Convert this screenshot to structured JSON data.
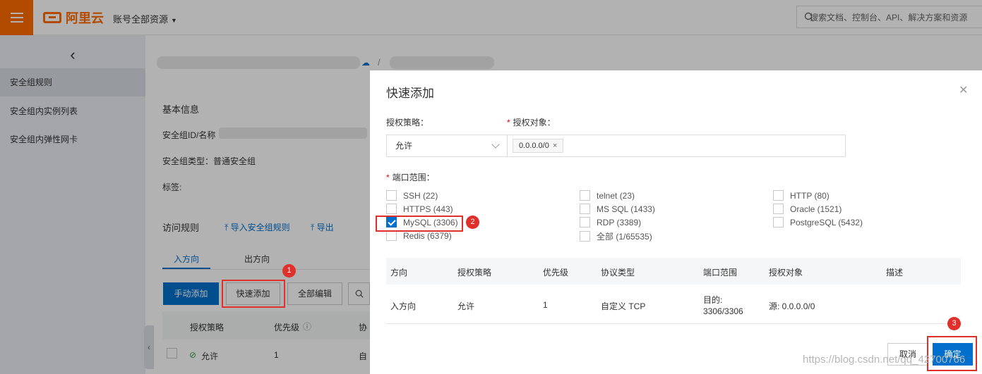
{
  "topbar": {
    "logo": "阿里云",
    "account": "账号全部资源",
    "search_placeholder": "搜索文档、控制台、API、解决方案和资源"
  },
  "sidebar": {
    "items": [
      {
        "label": "安全组规则",
        "active": true
      },
      {
        "label": "安全组内实例列表"
      },
      {
        "label": "安全组内弹性网卡"
      }
    ]
  },
  "main": {
    "breadcrumb_sep": "/",
    "basic_info": "基本信息",
    "sg_id_label": "安全组ID/名称",
    "sg_type": "安全组类型：普通安全组",
    "tags_label": "标签:",
    "rules_title": "访问规则",
    "import_label": "导入安全组规则",
    "export_label": "导出",
    "tabs": [
      {
        "label": "入方向",
        "active": true
      },
      {
        "label": "出方向"
      }
    ],
    "buttons": {
      "manual": "手动添加",
      "quick": "快速添加",
      "edit_all": "全部编辑"
    },
    "table_headers": [
      "授权策略",
      "优先级"
    ],
    "row": {
      "policy": "允许",
      "priority": "1",
      "proto": "自定"
    }
  },
  "modal": {
    "title": "快速添加",
    "policy_label": "授权策略：",
    "target_label": "授权对象：",
    "policy_value": "允许",
    "target_tag": "0.0.0.0/0",
    "port_label": "端口范围：",
    "ports": [
      {
        "label": "SSH (22)",
        "checked": false
      },
      {
        "label": "telnet (23)",
        "checked": false
      },
      {
        "label": "HTTP (80)",
        "checked": false
      },
      {
        "label": "HTTPS (443)",
        "checked": false
      },
      {
        "label": "MS SQL (1433)",
        "checked": false
      },
      {
        "label": "Oracle (1521)",
        "checked": false
      },
      {
        "label": "MySQL (3306)",
        "checked": true
      },
      {
        "label": "RDP (3389)",
        "checked": false
      },
      {
        "label": "PostgreSQL (5432)",
        "checked": false
      },
      {
        "label": "Redis (6379)",
        "checked": false
      },
      {
        "label": "全部 (1/65535)",
        "checked": false
      }
    ],
    "table": {
      "headers": [
        "方向",
        "授权策略",
        "优先级",
        "协议类型",
        "端口范围",
        "授权对象",
        "描述"
      ],
      "row": [
        "入方向",
        "允许",
        "1",
        "自定义 TCP",
        "目的:",
        "3306/3306",
        "源: 0.0.0.0/0"
      ]
    },
    "cancel": "取消",
    "confirm": "确定"
  },
  "annotations": [
    "1",
    "2",
    "3"
  ],
  "watermark": "https://blog.csdn.net/qq_42700766",
  "colors": {
    "brand": "#ff6a00",
    "primary": "#0070cc",
    "highlight": "#e0302b"
  }
}
